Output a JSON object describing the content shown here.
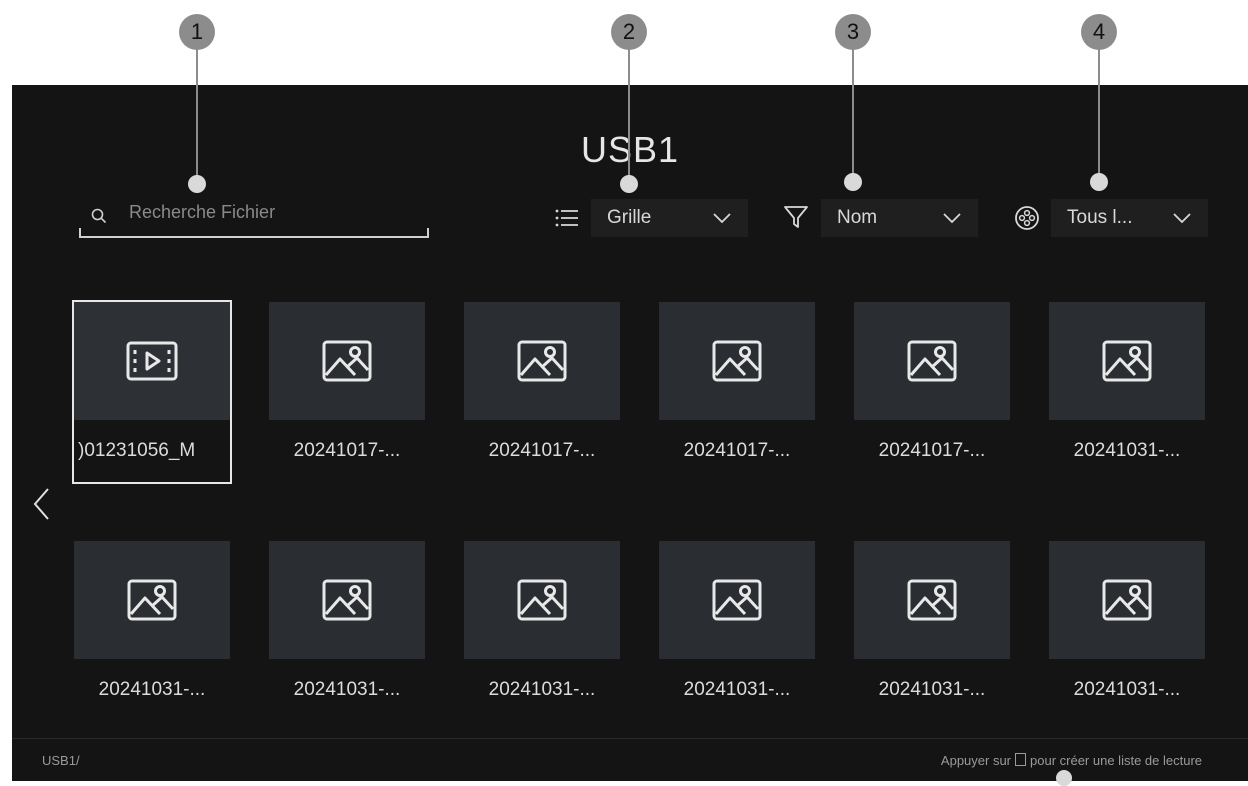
{
  "callouts": [
    "1",
    "2",
    "3",
    "4"
  ],
  "title": "USB1",
  "search": {
    "placeholder": "Recherche Fichier",
    "icon": "search-icon"
  },
  "view_mode": {
    "icon": "list-icon",
    "value": "Grille"
  },
  "sort": {
    "icon": "filter-icon",
    "value": "Nom"
  },
  "content_type": {
    "icon": "media-reel-icon",
    "value": "Tous l..."
  },
  "files": [
    {
      "name": ")01231056_M",
      "type": "video"
    },
    {
      "name": "20241017-...",
      "type": "image"
    },
    {
      "name": "20241017-...",
      "type": "image"
    },
    {
      "name": "20241017-...",
      "type": "image"
    },
    {
      "name": "20241017-...",
      "type": "image"
    },
    {
      "name": "20241031-...",
      "type": "image"
    },
    {
      "name": "20241031-...",
      "type": "image"
    },
    {
      "name": "20241031-...",
      "type": "image"
    },
    {
      "name": "20241031-...",
      "type": "image"
    },
    {
      "name": "20241031-...",
      "type": "image"
    },
    {
      "name": "20241031-...",
      "type": "image"
    },
    {
      "name": "20241031-...",
      "type": "image"
    }
  ],
  "footer": {
    "path": "USB1/",
    "hint_prefix": "Appuyer sur",
    "hint_suffix": "pour créer une liste de lecture"
  },
  "colors": {
    "screen_bg": "#141414",
    "tile_bg": "#2a2d31",
    "callout": "#8c8c8c"
  }
}
